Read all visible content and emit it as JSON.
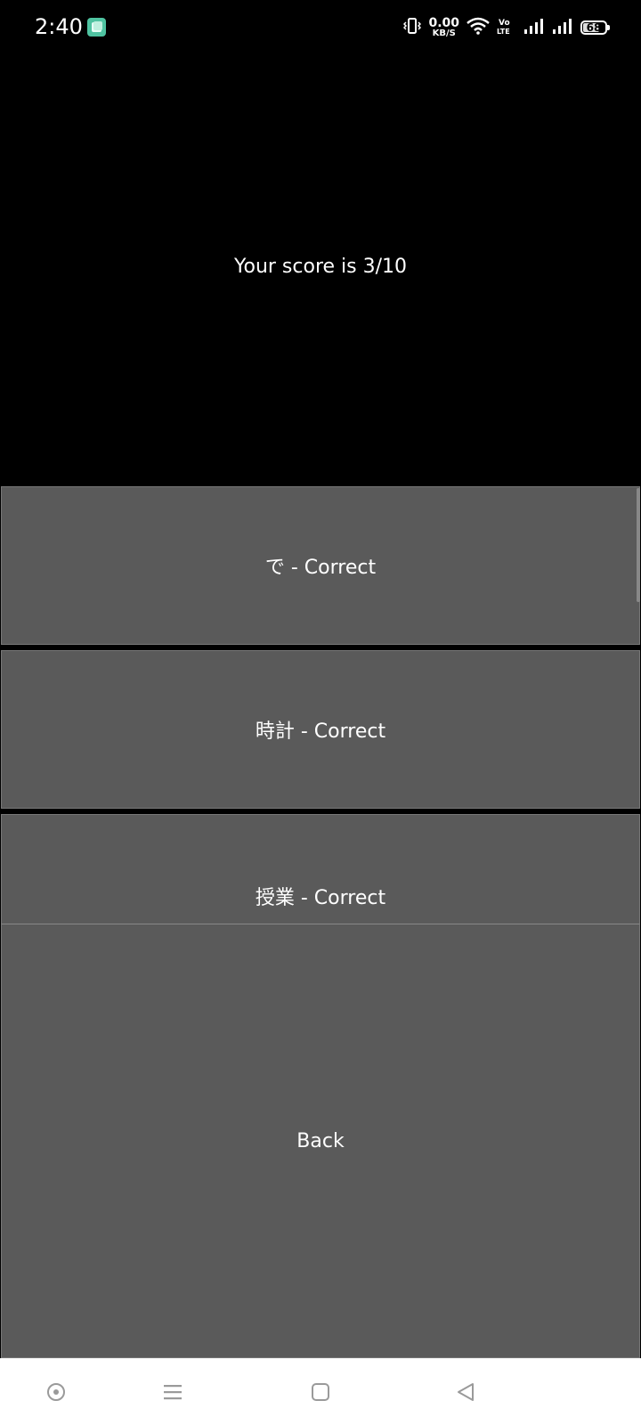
{
  "status_bar": {
    "time": "2:40",
    "net_speed_value": "0.00",
    "net_speed_unit": "KB/S",
    "battery_level": "68",
    "icons": [
      "app-notification-icon",
      "vibrate-icon",
      "wifi-icon",
      "volte-icon",
      "signal-icon",
      "signal-icon",
      "battery-icon"
    ]
  },
  "score": {
    "text": "Your score is 3/10"
  },
  "results": [
    {
      "label": "で - Correct"
    },
    {
      "label": "時計 - Correct"
    },
    {
      "label": "授業 - Correct"
    }
  ],
  "back_button": {
    "label": "Back"
  },
  "nav_bar": {
    "icons": [
      "assistant-icon",
      "menu-icon",
      "home-icon",
      "back-icon"
    ]
  },
  "colors": {
    "background": "#000000",
    "button": "#5a5a5a",
    "text": "#ffffff",
    "nav_bar": "#ffffff",
    "nav_icon": "#9a9a9a",
    "notification_accent": "#4fc3a1"
  }
}
